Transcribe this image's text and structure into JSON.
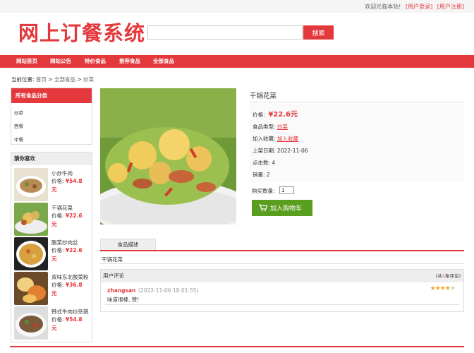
{
  "topbar": {
    "welcome": "欢迎光临本站!",
    "login": "[用户登录]",
    "register": "[用户注册]"
  },
  "header": {
    "logo_text": "网上订餐系统",
    "search_placeholder": "",
    "search_button": "搜索"
  },
  "nav": {
    "items": [
      "网站首页",
      "网站公告",
      "特价食品",
      "推荐食品",
      "全部食品"
    ]
  },
  "breadcrumb": {
    "prefix": "当前位置: ",
    "home": "首页",
    "sep1": " > ",
    "all": "全部食品",
    "sep2": " > ",
    "current": "炒菜"
  },
  "sidebar": {
    "category_title": "所有食品分类",
    "categories": [
      "炒菜",
      "西餐",
      "中餐"
    ],
    "guess_title": "猜你喜欢",
    "guess_items": [
      {
        "name": "小炒牛肉",
        "price_label": "价格:",
        "price": "¥54.8",
        "unit": "元",
        "thumb_color": "#b98b55"
      },
      {
        "name": "干锅花菜",
        "price_label": "价格:",
        "price": "¥22.6",
        "unit": "元",
        "thumb_color": "#d9b45a"
      },
      {
        "name": "酸菜炒肉丝",
        "price_label": "价格:",
        "price": "¥22.6",
        "unit": "元",
        "thumb_color": "#c79a3c"
      },
      {
        "name": "双味东北酸菜粉",
        "price_label": "价格:",
        "price": "¥36.8",
        "unit": "元",
        "thumb_color": "#d88a3a"
      },
      {
        "name": "韩式牛肉炒杂蔬",
        "price_label": "价格:",
        "price": "¥54.8",
        "unit": "元",
        "thumb_color": "#7a5a3a"
      }
    ]
  },
  "product": {
    "title": "干锅花菜",
    "price_label": "价格:",
    "price": "¥22.6元",
    "type_label": "食品类型:",
    "type_value": "炒菜",
    "fav_label": "加入收藏:",
    "fav_value": "加入收藏",
    "date_label": "上架日期:",
    "date_value": "2022-11-06",
    "clicks_label": "点击数:",
    "clicks_value": "4",
    "sales_label": "销量:",
    "sales_value": "2",
    "qty_label": "购买数量:",
    "qty_value": "1",
    "cart_button": "加入购物车"
  },
  "description": {
    "tab": "食品描述",
    "text": "干锅花菜"
  },
  "comments": {
    "title": "用户评论",
    "count_prefix": "(共",
    "count": "1",
    "count_suffix": "条评论)",
    "items": [
      {
        "user": "zhangsan",
        "time": "(2022-11-06 18:01:55)",
        "text": "味道很棒, 赞!",
        "rating": 4,
        "max_rating": 5
      }
    ]
  },
  "colors": {
    "accent": "#e4393c",
    "cart_green": "#5a9e1f",
    "star": "#f5a623"
  }
}
